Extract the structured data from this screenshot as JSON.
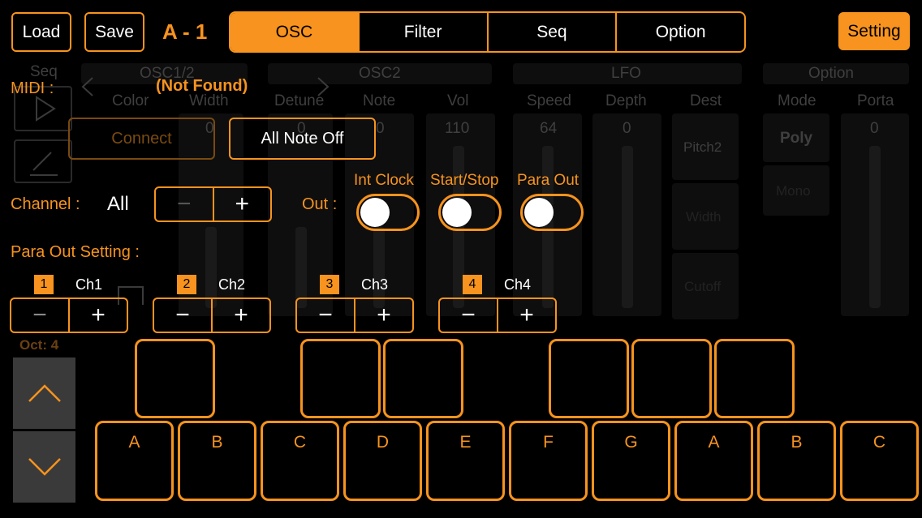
{
  "header": {
    "load_label": "Load",
    "save_label": "Save",
    "preset_name": "A - 1",
    "tabs": [
      "OSC",
      "Filter",
      "Seq",
      "Option"
    ],
    "active_tab": "OSC",
    "setting_label": "Setting"
  },
  "background_panel": {
    "sections": [
      "Seq",
      "OSC1/2",
      "OSC2",
      "LFO",
      "Option"
    ],
    "columns": [
      "Color",
      "Width",
      "Detune",
      "Note",
      "Vol",
      "Speed",
      "Depth",
      "Dest",
      "Mode",
      "Porta"
    ],
    "values": [
      "0",
      "0",
      "0",
      "110",
      "64",
      "0",
      "0"
    ],
    "dest_items": [
      "Pitch2",
      "Width",
      "Cutoff"
    ],
    "mode_items": [
      "Poly",
      "Mono"
    ]
  },
  "midi": {
    "label": "MIDI :",
    "status": "(Not Found)",
    "connect_label": "Connect",
    "all_note_off_label": "All Note Off"
  },
  "channel": {
    "label": "Channel :",
    "value": "All",
    "minus": "−",
    "plus": "+"
  },
  "out": {
    "label": "Out :",
    "toggles": [
      {
        "label": "Int Clock",
        "on": false
      },
      {
        "label": "Start/Stop",
        "on": false
      },
      {
        "label": "Para Out",
        "on": false
      }
    ]
  },
  "para_out": {
    "label": "Para Out Setting :",
    "channels": [
      {
        "num": "1",
        "name": "Ch1"
      },
      {
        "num": "2",
        "name": "Ch2"
      },
      {
        "num": "3",
        "name": "Ch3"
      },
      {
        "num": "4",
        "name": "Ch4"
      }
    ],
    "minus": "−",
    "plus": "+"
  },
  "keyboard": {
    "octave_label": "Oct: 4",
    "white_keys": [
      "A",
      "B",
      "C",
      "D",
      "E",
      "F",
      "G",
      "A",
      "B",
      "C"
    ]
  },
  "colors": {
    "accent": "#f7931e",
    "background": "#000000",
    "octave_button": "#3a3a3a"
  }
}
